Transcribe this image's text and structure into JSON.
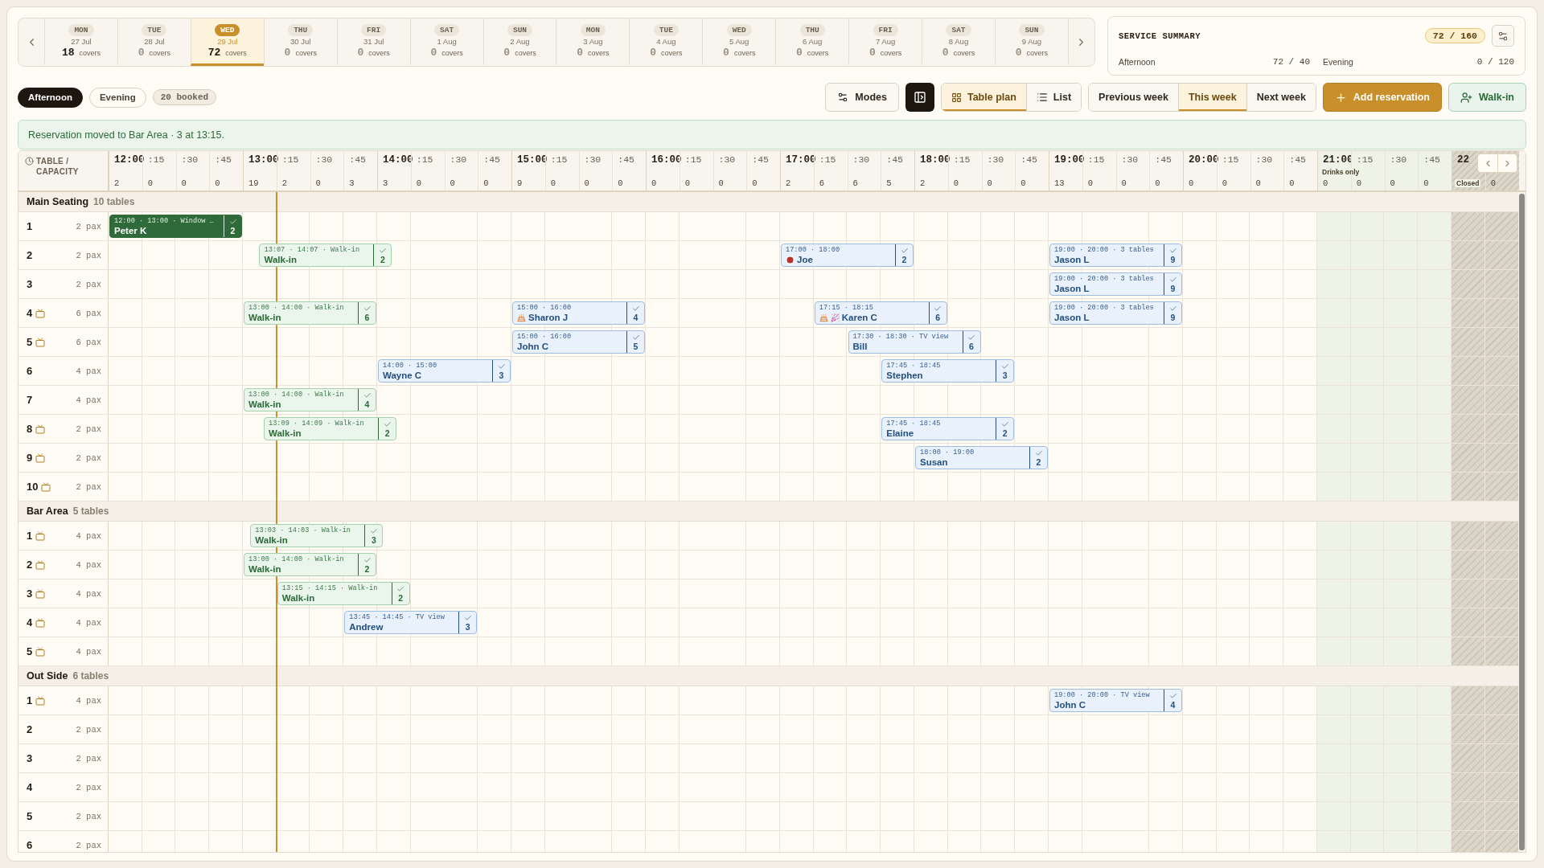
{
  "date_strip": {
    "days": [
      {
        "weekday": "MON",
        "date": "27 Jul",
        "covers": "18",
        "unit": "covers",
        "selected": false
      },
      {
        "weekday": "TUE",
        "date": "28 Jul",
        "covers": "0",
        "unit": "covers",
        "selected": false
      },
      {
        "weekday": "WED",
        "date": "29 Jul",
        "covers": "72",
        "unit": "covers",
        "selected": true
      },
      {
        "weekday": "THU",
        "date": "30 Jul",
        "covers": "0",
        "unit": "covers",
        "selected": false
      },
      {
        "weekday": "FRI",
        "date": "31 Jul",
        "covers": "0",
        "unit": "covers",
        "selected": false
      },
      {
        "weekday": "SAT",
        "date": "1 Aug",
        "covers": "0",
        "unit": "covers",
        "selected": false
      },
      {
        "weekday": "SUN",
        "date": "2 Aug",
        "covers": "0",
        "unit": "covers",
        "selected": false
      },
      {
        "weekday": "MON",
        "date": "3 Aug",
        "covers": "0",
        "unit": "covers",
        "selected": false
      },
      {
        "weekday": "TUE",
        "date": "4 Aug",
        "covers": "0",
        "unit": "covers",
        "selected": false
      },
      {
        "weekday": "WED",
        "date": "5 Aug",
        "covers": "0",
        "unit": "covers",
        "selected": false
      },
      {
        "weekday": "THU",
        "date": "6 Aug",
        "covers": "0",
        "unit": "covers",
        "selected": false
      },
      {
        "weekday": "FRI",
        "date": "7 Aug",
        "covers": "0",
        "unit": "covers",
        "selected": false
      },
      {
        "weekday": "SAT",
        "date": "8 Aug",
        "covers": "0",
        "unit": "covers",
        "selected": false
      },
      {
        "weekday": "SUN",
        "date": "9 Aug",
        "covers": "0",
        "unit": "covers",
        "selected": false
      }
    ]
  },
  "service_summary": {
    "title": "SERVICE SUMMARY",
    "total": "72 / 160",
    "services": [
      {
        "name": "Afternoon",
        "value": "72 / 40"
      },
      {
        "name": "Evening",
        "value": "0 / 120"
      }
    ]
  },
  "service_tabs": [
    {
      "label": "Afternoon",
      "selected": true
    },
    {
      "label": "Evening",
      "selected": false
    }
  ],
  "booked_badge": "20 booked",
  "toolbar": {
    "modes": "Modes",
    "views": [
      {
        "label": "Table plan",
        "kind": "grid",
        "selected": true
      },
      {
        "label": "List",
        "kind": "list",
        "selected": false
      }
    ],
    "weeks": [
      {
        "label": "Previous week",
        "selected": false
      },
      {
        "label": "This week",
        "selected": true
      },
      {
        "label": "Next week",
        "selected": false
      }
    ],
    "add": "Add reservation",
    "walk_in": "Walk-in"
  },
  "banner": "Reservation moved to Bar Area · 3 at 13:15.",
  "timeline": {
    "corner": "TABLE / CAPACITY",
    "slots": [
      {
        "kind": "hour",
        "label": "12:00",
        "count": "2"
      },
      {
        "kind": "quarter",
        "label": ":15",
        "count": "0"
      },
      {
        "kind": "quarter",
        "label": ":30",
        "count": "0"
      },
      {
        "kind": "quarter",
        "label": ":45",
        "count": "0"
      },
      {
        "kind": "hour",
        "label": "13:00",
        "count": "19"
      },
      {
        "kind": "quarter",
        "label": ":15",
        "count": "2"
      },
      {
        "kind": "quarter",
        "label": ":30",
        "count": "0"
      },
      {
        "kind": "quarter",
        "label": ":45",
        "count": "3"
      },
      {
        "kind": "hour",
        "label": "14:00",
        "count": "3"
      },
      {
        "kind": "quarter",
        "label": ":15",
        "count": "0"
      },
      {
        "kind": "quarter",
        "label": ":30",
        "count": "0"
      },
      {
        "kind": "quarter",
        "label": ":45",
        "count": "0"
      },
      {
        "kind": "hour",
        "label": "15:00",
        "count": "9"
      },
      {
        "kind": "quarter",
        "label": ":15",
        "count": "0"
      },
      {
        "kind": "quarter",
        "label": ":30",
        "count": "0"
      },
      {
        "kind": "quarter",
        "label": ":45",
        "count": "0"
      },
      {
        "kind": "hour",
        "label": "16:00",
        "count": "0"
      },
      {
        "kind": "quarter",
        "label": ":15",
        "count": "0"
      },
      {
        "kind": "quarter",
        "label": ":30",
        "count": "0"
      },
      {
        "kind": "quarter",
        "label": ":45",
        "count": "0"
      },
      {
        "kind": "hour",
        "label": "17:00",
        "count": "2"
      },
      {
        "kind": "quarter",
        "label": ":15",
        "count": "6"
      },
      {
        "kind": "quarter",
        "label": ":30",
        "count": "6"
      },
      {
        "kind": "quarter",
        "label": ":45",
        "count": "5"
      },
      {
        "kind": "hour",
        "label": "18:00",
        "count": "2"
      },
      {
        "kind": "quarter",
        "label": ":15",
        "count": "0"
      },
      {
        "kind": "quarter",
        "label": ":30",
        "count": "0"
      },
      {
        "kind": "quarter",
        "label": ":45",
        "count": "0"
      },
      {
        "kind": "hour",
        "label": "19:00",
        "count": "13"
      },
      {
        "kind": "quarter",
        "label": ":15",
        "count": "0"
      },
      {
        "kind": "quarter",
        "label": ":30",
        "count": "0"
      },
      {
        "kind": "quarter",
        "label": ":45",
        "count": "0"
      },
      {
        "kind": "hour",
        "label": "20:00",
        "count": "0"
      },
      {
        "kind": "quarter",
        "label": ":15",
        "count": "0"
      },
      {
        "kind": "quarter",
        "label": ":30",
        "count": "0"
      },
      {
        "kind": "quarter",
        "label": ":45",
        "count": "0"
      },
      {
        "kind": "hour",
        "label": "21:00",
        "tag": "Drinks only",
        "count": "0",
        "drinks_only": true
      },
      {
        "kind": "quarter",
        "label": ":15",
        "count": "0",
        "drinks_only": true
      },
      {
        "kind": "quarter",
        "label": ":30",
        "count": "0",
        "drinks_only": true
      },
      {
        "kind": "quarter",
        "label": ":45",
        "count": "0",
        "drinks_only": true
      },
      {
        "kind": "hour",
        "label": "22",
        "tag": "Closed",
        "closed": true
      },
      {
        "kind": "quarter",
        "count": "0",
        "closed": true
      }
    ]
  },
  "areas": [
    {
      "name": "Main Seating",
      "count": "10 tables",
      "tables": [
        {
          "number": "1",
          "tv": false,
          "capacity": "2 pax",
          "reservations": [
            {
              "kind": "seated",
              "info": "12:00 · 13:00 · Window …",
              "name": "Peter K",
              "party": "2",
              "confirmed": true
            }
          ]
        },
        {
          "number": "2",
          "tv": false,
          "capacity": "2 pax",
          "reservations": [
            {
              "kind": "walkin",
              "info": "13:07 · 14:07 · Walk-in",
              "name": "Walk-in",
              "party": "2",
              "confirmed": true
            },
            {
              "kind": "booked",
              "info": "17:00 · 18:00",
              "name": "Joe",
              "allergy": true,
              "party": "2",
              "confirmed": true
            },
            {
              "kind": "booked",
              "info": "19:00 · 20:00 · 3 tables",
              "name": "Jason L",
              "party": "9",
              "confirmed": true
            }
          ]
        },
        {
          "number": "3",
          "tv": false,
          "capacity": "2 pax",
          "reservations": [
            {
              "kind": "booked",
              "info": "19:00 · 20:00 · 3 tables",
              "name": "Jason L",
              "party": "9",
              "confirmed": true
            }
          ]
        },
        {
          "number": "4",
          "tv": true,
          "capacity": "6 pax",
          "reservations": [
            {
              "kind": "walkin",
              "info": "13:00 · 14:00 · Walk-in",
              "name": "Walk-in",
              "party": "6",
              "confirmed": true
            },
            {
              "kind": "booked",
              "info": "15:00 · 16:00",
              "name": "Sharon J",
              "birthday": true,
              "party": "4",
              "confirmed": true
            },
            {
              "kind": "booked",
              "info": "17:15 · 18:15",
              "name": "Karen C",
              "birthday": true,
              "celebration": true,
              "party": "6",
              "confirmed": true
            },
            {
              "kind": "booked",
              "info": "19:00 · 20:00 · 3 tables",
              "name": "Jason L",
              "party": "9",
              "confirmed": true
            }
          ]
        },
        {
          "number": "5",
          "tv": true,
          "capacity": "6 pax",
          "reservations": [
            {
              "kind": "booked",
              "info": "15:00 · 16:00",
              "name": "John C",
              "party": "5",
              "confirmed": true
            },
            {
              "kind": "booked",
              "info": "17:30 · 18:30 · TV view",
              "name": "Bill",
              "party": "6",
              "confirmed": true
            }
          ]
        },
        {
          "number": "6",
          "tv": false,
          "capacity": "4 pax",
          "reservations": [
            {
              "kind": "booked",
              "info": "14:00 · 15:00",
              "name": "Wayne C",
              "party": "3",
              "confirmed": true
            },
            {
              "kind": "booked",
              "info": "17:45 · 18:45",
              "name": "Stephen",
              "party": "3",
              "confirmed": true
            }
          ]
        },
        {
          "number": "7",
          "tv": false,
          "capacity": "4 pax",
          "reservations": [
            {
              "kind": "walkin",
              "info": "13:00 · 14:00 · Walk-in",
              "name": "Walk-in",
              "party": "4",
              "confirmed": true
            }
          ]
        },
        {
          "number": "8",
          "tv": true,
          "capacity": "2 pax",
          "reservations": [
            {
              "kind": "walkin",
              "info": "13:09 · 14:09 · Walk-in",
              "name": "Walk-in",
              "party": "2",
              "confirmed": true
            },
            {
              "kind": "booked",
              "info": "17:45 · 18:45",
              "name": "Elaine",
              "party": "2",
              "confirmed": true
            }
          ]
        },
        {
          "number": "9",
          "tv": true,
          "capacity": "2 pax",
          "reservations": [
            {
              "kind": "booked",
              "info": "18:00 · 19:00",
              "name": "Susan",
              "party": "2",
              "confirmed": true
            }
          ]
        },
        {
          "number": "10",
          "tv": true,
          "capacity": "2 pax"
        }
      ]
    },
    {
      "name": "Bar Area",
      "count": "5 tables",
      "tables": [
        {
          "number": "1",
          "tv": true,
          "capacity": "4 pax",
          "reservations": [
            {
              "kind": "walkin",
              "info": "13:03 · 14:03 · Walk-in",
              "name": "Walk-in",
              "party": "3",
              "confirmed": true
            }
          ]
        },
        {
          "number": "2",
          "tv": true,
          "capacity": "4 pax",
          "reservations": [
            {
              "kind": "walkin",
              "info": "13:00 · 14:00 · Walk-in",
              "name": "Walk-in",
              "party": "2",
              "confirmed": true
            }
          ]
        },
        {
          "number": "3",
          "tv": true,
          "capacity": "4 pax",
          "reservations": [
            {
              "kind": "walkin",
              "info": "13:15 · 14:15 · Walk-in",
              "name": "Walk-in",
              "party": "2",
              "confirmed": true
            }
          ]
        },
        {
          "number": "4",
          "tv": true,
          "capacity": "4 pax",
          "reservations": [
            {
              "kind": "booked",
              "info": "13:45 · 14:45 · TV view",
              "name": "Andrew",
              "party": "3",
              "confirmed": true
            }
          ]
        },
        {
          "number": "5",
          "tv": true,
          "capacity": "4 pax"
        }
      ]
    },
    {
      "name": "Out Side",
      "count": "6 tables",
      "tables": [
        {
          "number": "1",
          "tv": true,
          "capacity": "4 pax",
          "reservations": [
            {
              "kind": "booked",
              "info": "19:00 · 20:00 · TV view",
              "name": "John C",
              "party": "4",
              "confirmed": true
            }
          ]
        },
        {
          "number": "2",
          "tv": false,
          "capacity": "2 pax"
        },
        {
          "number": "3",
          "tv": false,
          "capacity": "2 pax"
        },
        {
          "number": "4",
          "tv": false,
          "capacity": "2 pax"
        },
        {
          "number": "5",
          "tv": false,
          "capacity": "2 pax"
        },
        {
          "number": "6",
          "tv": false,
          "capacity": "2 pax"
        }
      ]
    }
  ]
}
